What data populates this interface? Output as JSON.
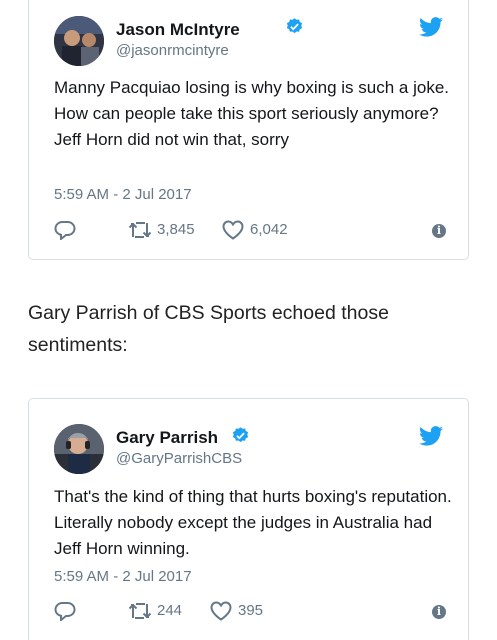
{
  "colors": {
    "twitter_blue": "#1da1f2",
    "verified_blue": "#1da1f2",
    "secondary_text": "#657786",
    "card_border": "#d8dee3"
  },
  "tweets": [
    {
      "name": "Jason McIntyre",
      "handle": "@jasonrmcintyre",
      "text": "Manny Pacquiao losing is why boxing is such a joke. How can people take this sport seriously anymore? Jeff Horn did not win that, sorry",
      "timestamp": "5:59 AM - 2 Jul 2017",
      "retweets": "3,845",
      "likes": "6,042",
      "icons": [
        "reply-icon",
        "retweet-icon",
        "like-icon",
        "info-icon",
        "twitter-bird-icon",
        "verified-icon"
      ]
    },
    {
      "name": "Gary Parrish",
      "handle": "@GaryParrishCBS",
      "text": "That's the kind of thing that hurts boxing's reputation. Literally nobody except the judges in Australia had Jeff Horn winning.",
      "timestamp": "5:59 AM - 2 Jul 2017",
      "retweets": "244",
      "likes": "395",
      "icons": [
        "reply-icon",
        "retweet-icon",
        "like-icon",
        "info-icon",
        "twitter-bird-icon",
        "verified-icon"
      ]
    }
  ],
  "article": {
    "paragraph": "Gary Parrish of CBS Sports echoed those sentiments:"
  }
}
